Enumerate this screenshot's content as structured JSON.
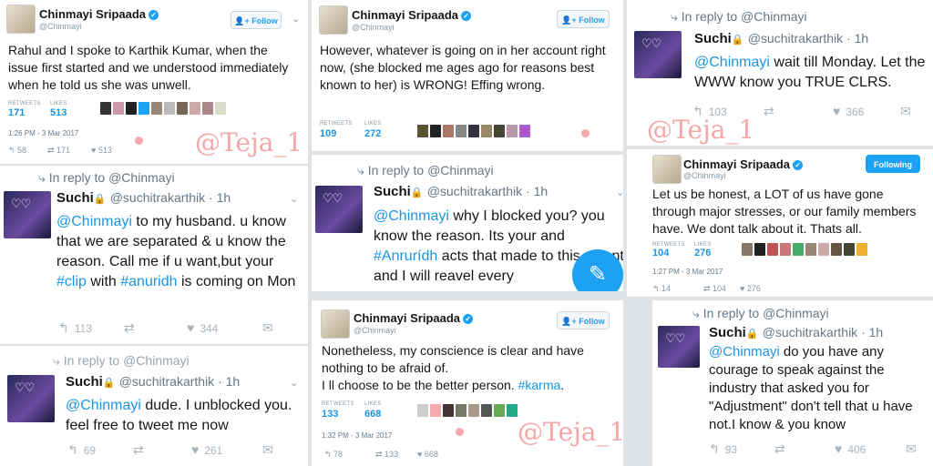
{
  "watermark": "@Teja_1",
  "follow_label": "Follow",
  "following_label": "Following",
  "retweets_label": "RETWEETS",
  "likes_label": "LIKES",
  "reply_prefix": "In reply to @Chinmayi",
  "tweets": [
    {
      "name": "Chinmayi Sripaada",
      "handle": "@Chinmayi",
      "text": "Rahul and I spoke to Karthik Kumar, when the issue first started and we understood immediately when he told us she was unwell.",
      "retweets": "171",
      "likes": "513",
      "timestamp": "1:26 PM - 3 Mar 2017",
      "act_reply": "58",
      "act_retweet": "171",
      "act_like": "513"
    },
    {
      "name": "Chinmayi Sripaada",
      "handle": "@Chinmayi",
      "text": "However, whatever is going on in her account right now, (she blocked me ages ago for reasons best known to her) is WRONG! Effing wrong.",
      "retweets": "109",
      "likes": "272"
    },
    {
      "name": "Chinmayi Sripaada",
      "handle": "@Chinmayi",
      "text": "Let us be honest, a LOT of us have gone through major stresses, or our family members have. We dont talk about it. Thats all.",
      "retweets": "104",
      "likes": "276",
      "timestamp": "1:27 PM - 3 Mar 2017",
      "act_reply": "14",
      "act_retweet": "104",
      "act_like": "276"
    },
    {
      "name": "Chinmayi Sripaada",
      "handle": "@Chinmayi",
      "text_lines": [
        "Nonetheless, my conscience is clear and have nothing to be afraid of.",
        "I ll choose to be the better person. "
      ],
      "hashtag": "#karma",
      "text_end": ".",
      "retweets": "133",
      "likes": "668",
      "timestamp": "1:32 PM - 3 Mar 2017",
      "act_reply": "78",
      "act_retweet": "133",
      "act_like": "668"
    }
  ],
  "replies": [
    {
      "name": "Suchi",
      "handle": "@suchitrakarthik · 1h",
      "mention": "@Chinmayi",
      "text": " to my husband. u know that we are separated & u know the reason. Call me if u want,but your ",
      "tag1": "#clip",
      "mid": " with ",
      "tag2": "#anuridh",
      "end": " is coming on Mon",
      "replies": "113",
      "likes": "344"
    },
    {
      "name": "Suchi",
      "handle": "@suchitrakarthik · 1h",
      "mention": "@Chinmayi",
      "text": " dude. I unblocked you. feel free to tweet me now",
      "replies": "69",
      "likes": "261"
    },
    {
      "name": "Suchi",
      "handle": "@suchitrakarthik · 1h",
      "mention": "@Chinmayi",
      "text": " why I blocked you? you know the reason. Its your and ",
      "tag1": "#Anrurídh",
      "end": " acts that made to this extent and I will reavel every"
    },
    {
      "name": "Suchi",
      "handle": "@suchitrakarthik · 1h",
      "mention": "@Chinmayi",
      "text": " wait till Monday. Let the WWW know you TRUE CLRS.",
      "replies": "103",
      "likes": "366"
    },
    {
      "name": "Suchi",
      "handle": "@suchitrakarthik · 1h",
      "mention": "@Chinmayi",
      "text": " do you have any courage to speak against the industry that asked you for \"Adjustment\" don't tell that u have not.I know & you know",
      "replies": "93",
      "likes": "406"
    }
  ]
}
